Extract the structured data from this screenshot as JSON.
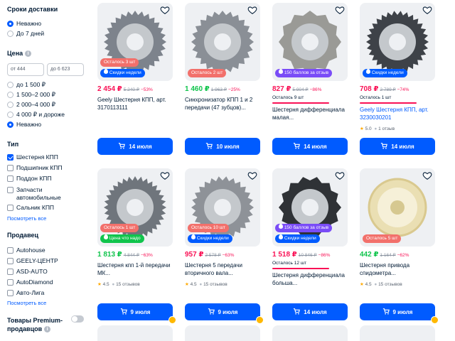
{
  "sidebar": {
    "delivery_title": "Сроки доставки",
    "delivery_options": [
      "Неважно",
      "До 7 дней"
    ],
    "price_title": "Цена",
    "price_from": "от 444",
    "price_to": "до 6 623",
    "price_options": [
      "до 1 500 ₽",
      "1 500–2 000 ₽",
      "2 000–4 000 ₽",
      "4 000 ₽ и дороже",
      "Неважно"
    ],
    "type_title": "Тип",
    "type_options": [
      "Шестерня КПП",
      "Подшипник КПП",
      "Поддон КПП",
      "Запчасти автомобильные",
      "Сальник КПП"
    ],
    "type_see_all": "Посмотреть все",
    "seller_title": "Продавец",
    "seller_options": [
      "Autohouse",
      "GEELY-ЦЕНТР",
      "ASD-AUTO",
      "AutoDiamond",
      "Авто-Лига"
    ],
    "seller_see_all": "Посмотреть все",
    "premium_title": "Товары Premium-продавцов"
  },
  "colors": {
    "accent": "#005bff",
    "price_red": "#f91155",
    "price_green": "#10c44c",
    "badge_left": "#f2706b",
    "badge_points": "#7a4cf7"
  },
  "products": [
    {
      "badges": [
        "Осталось 3 шт",
        "Скидки недели"
      ],
      "price": "2 454 ₽",
      "old_price": "5 240 ₽",
      "discount": "−53%",
      "price_color": "red",
      "left": "",
      "title": "Geely Шестерня КПП, арт. 3170113111",
      "title_link": false,
      "rating": "",
      "reviews": "",
      "delivery": "14 июля",
      "coin": false
    },
    {
      "badges": [
        "Осталось 2 шт"
      ],
      "price": "1 460 ₽",
      "old_price": "1 963 ₽",
      "discount": "−25%",
      "price_color": "green",
      "left": "",
      "title": "Синхронизатор КПП 1 и 2 передачи (47 зубцов)...",
      "title_link": false,
      "rating": "",
      "reviews": "",
      "delivery": "10 июля",
      "coin": false
    },
    {
      "badges": [
        "150 баллов за отзыв"
      ],
      "price": "827 ₽",
      "old_price": "5 904 ₽",
      "discount": "−86%",
      "price_color": "red",
      "left": "Осталось 9 шт",
      "title": "Шестерня дифференциала малая...",
      "title_link": false,
      "rating": "",
      "reviews": "",
      "delivery": "14 июля",
      "coin": false
    },
    {
      "badges": [
        "Скидки недели"
      ],
      "price": "708 ₽",
      "old_price": "2 789 ₽",
      "discount": "−74%",
      "price_color": "red",
      "left": "Осталось 1 шт",
      "title": "Geely Шестерня КПП, арт. 3230030201",
      "title_link": true,
      "rating": "5.0",
      "reviews": "1 отзыв",
      "delivery": "14 июля",
      "coin": false
    },
    {
      "badges": [
        "Осталось 1 шт",
        "Цена что надо"
      ],
      "price": "1 813 ₽",
      "old_price": "4 844 ₽",
      "discount": "−63%",
      "price_color": "green",
      "left": "",
      "title": "Шестерня кпп 1-й передачи МК...",
      "title_link": false,
      "rating": "4.5",
      "reviews": "15 отзывов",
      "delivery": "9 июля",
      "coin": true
    },
    {
      "badges": [
        "Осталось 10 шт",
        "Скидки недели"
      ],
      "price": "957 ₽",
      "old_price": "2 578 ₽",
      "discount": "−63%",
      "price_color": "red",
      "left": "",
      "title": "Шестерня 5 передачи вторичного вала...",
      "title_link": false,
      "rating": "4.5",
      "reviews": "15 отзывов",
      "delivery": "9 июля",
      "coin": true
    },
    {
      "badges": [
        "150 баллов за отзыв",
        "Скидки недели"
      ],
      "price": "1 518 ₽",
      "old_price": "10 846 ₽",
      "discount": "−86%",
      "price_color": "red",
      "left": "Осталось 12 шт",
      "title": "Шестерня дифференциала больша...",
      "title_link": false,
      "rating": "",
      "reviews": "",
      "delivery": "14 июля",
      "coin": false
    },
    {
      "badges": [
        "Осталось 5 шт"
      ],
      "price": "442 ₽",
      "old_price": "1 164 ₽",
      "discount": "−62%",
      "price_color": "green",
      "left": "",
      "title": "Шестерня привода спидометра...",
      "title_link": false,
      "rating": "4.5",
      "reviews": "15 отзывов",
      "delivery": "9 июля",
      "coin": true
    }
  ]
}
